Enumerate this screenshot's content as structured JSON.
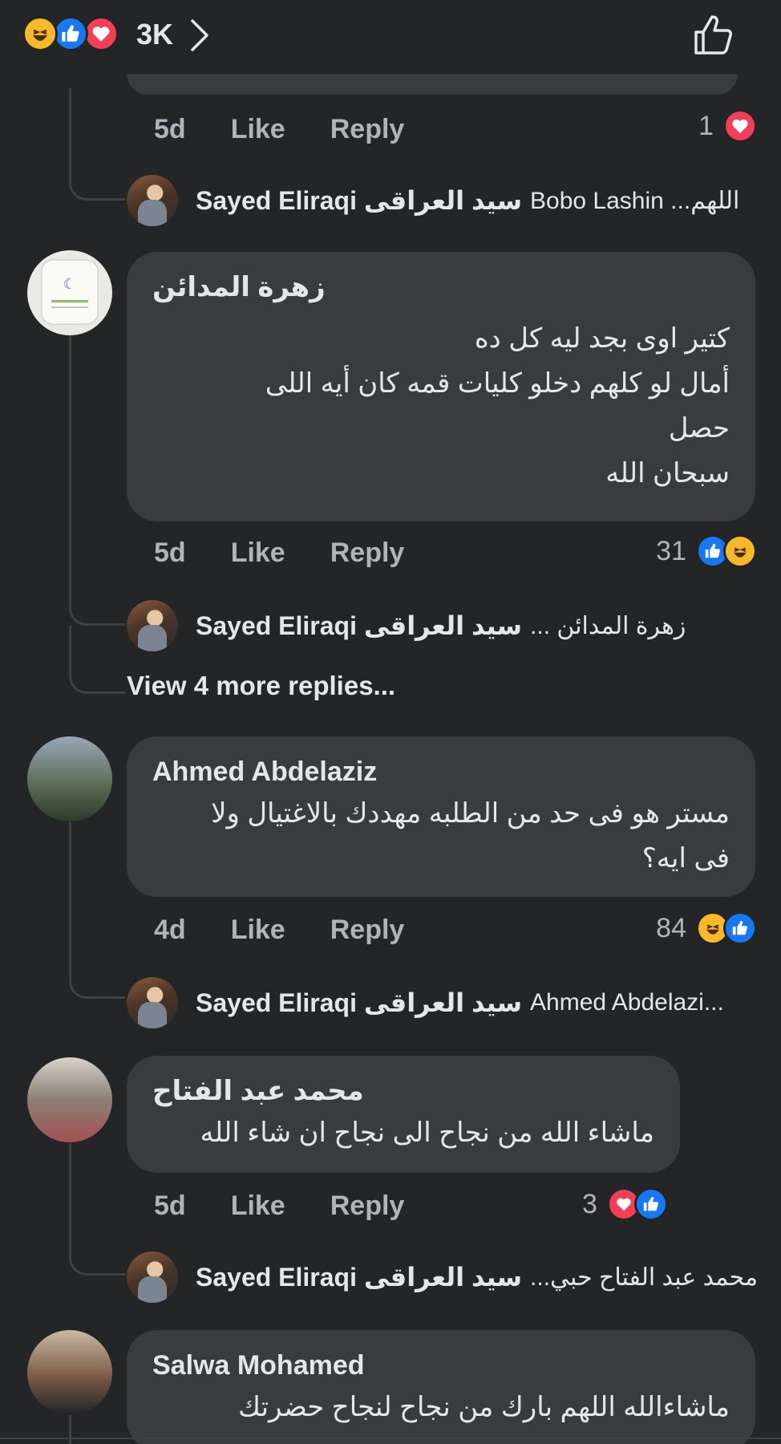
{
  "header": {
    "reaction_count": "3K",
    "icons": [
      "haha-icon",
      "like-icon",
      "love-icon"
    ]
  },
  "colors": {
    "background": "#242526",
    "bubble": "#3a3b3c",
    "like_blue": "#1877f2",
    "love_red": "#f33e58",
    "haha_yellow": "#f7b928"
  },
  "comments": [
    {
      "time": "5d",
      "like": "Like",
      "reply": "Reply",
      "reaction_count": "1",
      "reactions": [
        "love-icon"
      ],
      "reply_preview": {
        "name": "Sayed Eliraqi سيد العراقى",
        "text": "Bobo Lashin ...اللهم"
      }
    },
    {
      "author": "زهرة المدائن",
      "lines": [
        "كتير اوى بجد ليه كل ده",
        "أمال لو كلهم دخلو كليات قمه كان أيه اللى",
        "حصل",
        "سبحان الله"
      ],
      "time": "5d",
      "like": "Like",
      "reply": "Reply",
      "reaction_count": "31",
      "reactions": [
        "like-icon",
        "haha-icon"
      ],
      "reply_preview": {
        "name": "Sayed Eliraqi سيد العراقى",
        "text": "... زهرة المدائن"
      },
      "view_more": "View 4 more replies..."
    },
    {
      "author": "Ahmed Abdelaziz",
      "lines": [
        "مستر هو فى حد من الطلبه مهددك بالاغتيال ولا",
        "فى ايه؟"
      ],
      "time": "4d",
      "like": "Like",
      "reply": "Reply",
      "reaction_count": "84",
      "reactions": [
        "haha-icon",
        "like-icon"
      ],
      "reply_preview": {
        "name": "Sayed Eliraqi سيد العراقى",
        "text": "Ahmed Abdelazi..."
      }
    },
    {
      "author": "محمد عبد الفتاح",
      "lines": [
        "ماشاء الله من نجاح الى نجاح ان شاء الله"
      ],
      "time": "5d",
      "like": "Like",
      "reply": "Reply",
      "reaction_count": "3",
      "reactions": [
        "love-icon",
        "like-icon"
      ],
      "reply_preview": {
        "name": "Sayed Eliraqi سيد العراقى",
        "text": "...محمد عبد الفتاح حبي"
      }
    },
    {
      "author": "Salwa Mohamed",
      "lines": [
        "ماشاءالله اللهم بارك من نجاح لنجاح حضرتك"
      ]
    }
  ]
}
